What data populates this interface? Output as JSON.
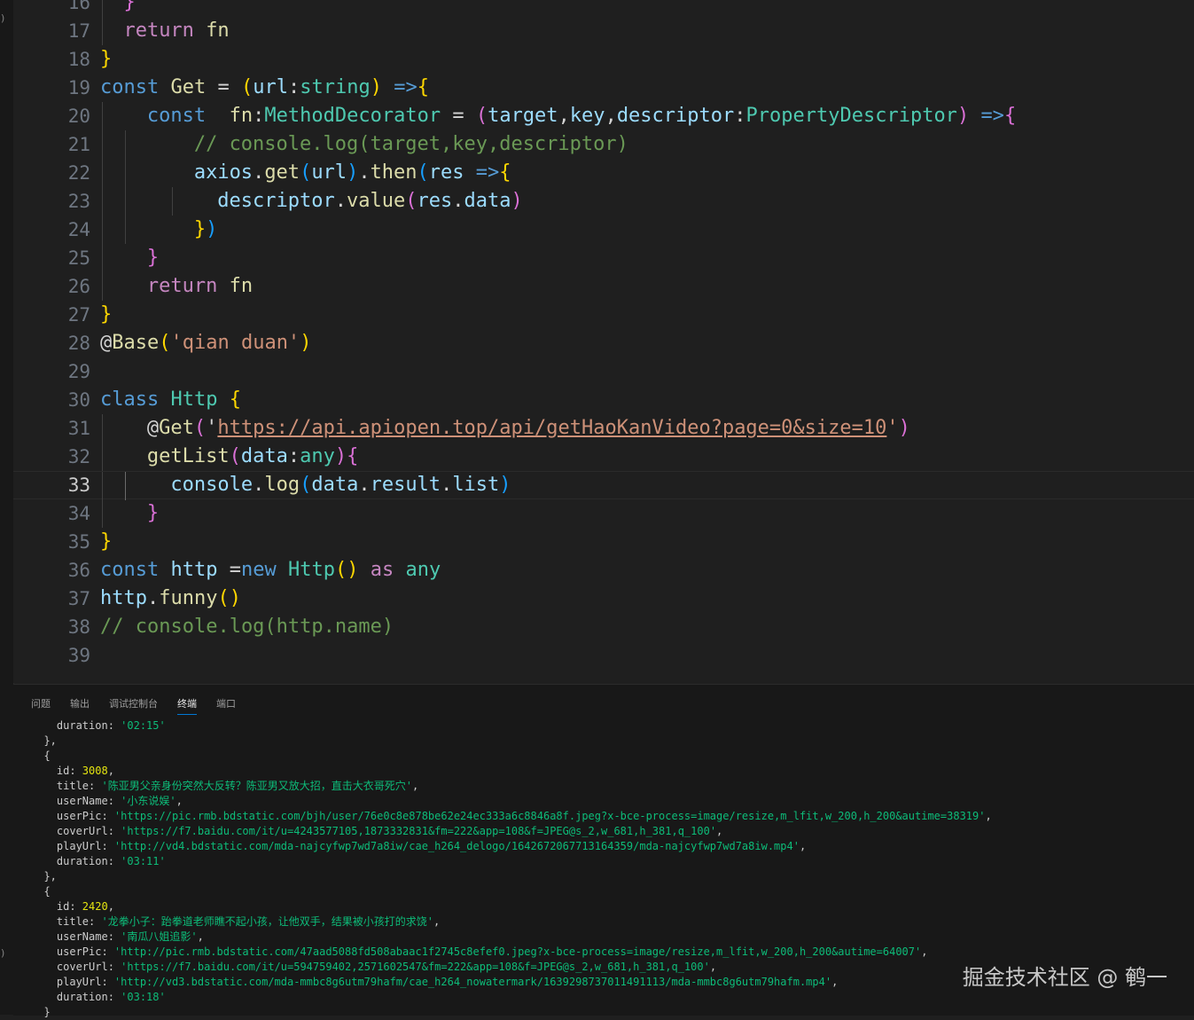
{
  "editor": {
    "lines": [
      {
        "num": "16",
        "tokens": [
          {
            "t": "}",
            "c": "b2"
          }
        ],
        "indent": 1,
        "guides": [
          1
        ]
      },
      {
        "num": "17",
        "tokens": [
          {
            "t": "return",
            "c": "ctl"
          },
          {
            "t": " "
          },
          {
            "t": "fn",
            "c": "fn"
          }
        ],
        "indent": 1,
        "guides": [
          1
        ]
      },
      {
        "num": "18",
        "tokens": [
          {
            "t": "}",
            "c": "b1"
          }
        ]
      },
      {
        "num": "19",
        "tokens": [
          {
            "t": "const",
            "c": "kw"
          },
          {
            "t": " "
          },
          {
            "t": "Get",
            "c": "fn"
          },
          {
            "t": " = "
          },
          {
            "t": "(",
            "c": "b1"
          },
          {
            "t": "url",
            "c": "var"
          },
          {
            "t": ":"
          },
          {
            "t": "string",
            "c": "type"
          },
          {
            "t": ")",
            "c": "b1"
          },
          {
            "t": " "
          },
          {
            "t": "=>",
            "c": "kw"
          },
          {
            "t": "{",
            "c": "b1"
          }
        ]
      },
      {
        "num": "20",
        "tokens": [
          {
            "t": "const",
            "c": "kw"
          },
          {
            "t": "  "
          },
          {
            "t": "fn",
            "c": "fn"
          },
          {
            "t": ":"
          },
          {
            "t": "MethodDecorator",
            "c": "type"
          },
          {
            "t": " = "
          },
          {
            "t": "(",
            "c": "b2"
          },
          {
            "t": "target",
            "c": "var"
          },
          {
            "t": ","
          },
          {
            "t": "key",
            "c": "var"
          },
          {
            "t": ","
          },
          {
            "t": "descriptor",
            "c": "var"
          },
          {
            "t": ":"
          },
          {
            "t": "PropertyDescriptor",
            "c": "type"
          },
          {
            "t": ")",
            "c": "b2"
          },
          {
            "t": " "
          },
          {
            "t": "=>",
            "c": "kw"
          },
          {
            "t": "{",
            "c": "b2"
          }
        ],
        "indent": 2,
        "guides": [
          1
        ]
      },
      {
        "num": "21",
        "tokens": [
          {
            "t": "// console.log(target,key,descriptor)",
            "c": "cm"
          }
        ],
        "indent": 4,
        "guides": [
          1,
          2
        ]
      },
      {
        "num": "22",
        "tokens": [
          {
            "t": "axios",
            "c": "var"
          },
          {
            "t": "."
          },
          {
            "t": "get",
            "c": "fn"
          },
          {
            "t": "(",
            "c": "b3"
          },
          {
            "t": "url",
            "c": "var"
          },
          {
            "t": ")",
            "c": "b3"
          },
          {
            "t": "."
          },
          {
            "t": "then",
            "c": "fn"
          },
          {
            "t": "(",
            "c": "b3"
          },
          {
            "t": "res",
            "c": "var"
          },
          {
            "t": " "
          },
          {
            "t": "=>",
            "c": "kw"
          },
          {
            "t": "{",
            "c": "b1"
          }
        ],
        "indent": 4,
        "guides": [
          1,
          2
        ]
      },
      {
        "num": "23",
        "tokens": [
          {
            "t": "descriptor",
            "c": "var"
          },
          {
            "t": "."
          },
          {
            "t": "value",
            "c": "fn"
          },
          {
            "t": "(",
            "c": "b2"
          },
          {
            "t": "res",
            "c": "var"
          },
          {
            "t": "."
          },
          {
            "t": "data",
            "c": "var"
          },
          {
            "t": ")",
            "c": "b2"
          }
        ],
        "indent": 5,
        "guides": [
          1,
          2,
          4
        ]
      },
      {
        "num": "24",
        "tokens": [
          {
            "t": "}",
            "c": "b1"
          },
          {
            "t": ")",
            "c": "b3"
          }
        ],
        "indent": 4,
        "guides": [
          1,
          2
        ]
      },
      {
        "num": "25",
        "tokens": [
          {
            "t": "}",
            "c": "b2"
          }
        ],
        "indent": 2,
        "guides": [
          1
        ]
      },
      {
        "num": "26",
        "tokens": [
          {
            "t": "return",
            "c": "ctl"
          },
          {
            "t": " "
          },
          {
            "t": "fn",
            "c": "fn"
          }
        ],
        "indent": 2,
        "guides": [
          1
        ]
      },
      {
        "num": "27",
        "tokens": [
          {
            "t": "}",
            "c": "b1"
          }
        ]
      },
      {
        "num": "28",
        "tokens": [
          {
            "t": "@"
          },
          {
            "t": "Base",
            "c": "fn"
          },
          {
            "t": "(",
            "c": "b1"
          },
          {
            "t": "'qian duan'",
            "c": "str"
          },
          {
            "t": ")",
            "c": "b1"
          }
        ]
      },
      {
        "num": "29",
        "tokens": []
      },
      {
        "num": "30",
        "tokens": [
          {
            "t": "class",
            "c": "kw"
          },
          {
            "t": " "
          },
          {
            "t": "Http",
            "c": "cls"
          },
          {
            "t": " "
          },
          {
            "t": "{",
            "c": "b1"
          }
        ]
      },
      {
        "num": "31",
        "tokens": [
          {
            "t": "@"
          },
          {
            "t": "Get",
            "c": "fn"
          },
          {
            "t": "(",
            "c": "b2"
          },
          {
            "t": "'"
          },
          {
            "t": "https://api.apiopen.top/api/getHaoKanVideo?page=0&size=10",
            "c": "str url"
          },
          {
            "t": "'",
            "c": "str"
          },
          {
            "t": ")",
            "c": "b2"
          }
        ],
        "indent": 2,
        "guides": [
          1
        ]
      },
      {
        "num": "32",
        "tokens": [
          {
            "t": "getList",
            "c": "fn"
          },
          {
            "t": "(",
            "c": "b2"
          },
          {
            "t": "data",
            "c": "var"
          },
          {
            "t": ":"
          },
          {
            "t": "any",
            "c": "type"
          },
          {
            "t": ")",
            "c": "b2"
          },
          {
            "t": "{",
            "c": "b2"
          }
        ],
        "indent": 2,
        "guides": [
          1
        ]
      },
      {
        "num": "33",
        "tokens": [
          {
            "t": "console",
            "c": "var"
          },
          {
            "t": "."
          },
          {
            "t": "log",
            "c": "fn"
          },
          {
            "t": "(",
            "c": "b3"
          },
          {
            "t": "data",
            "c": "var"
          },
          {
            "t": "."
          },
          {
            "t": "result",
            "c": "var"
          },
          {
            "t": "."
          },
          {
            "t": "list",
            "c": "var"
          },
          {
            "t": ")",
            "c": "b3"
          }
        ],
        "indent": 3,
        "guides": [
          1,
          2
        ],
        "current": true
      },
      {
        "num": "34",
        "tokens": [
          {
            "t": "}",
            "c": "b2"
          }
        ],
        "indent": 2,
        "guides": [
          1
        ]
      },
      {
        "num": "35",
        "tokens": [
          {
            "t": "}",
            "c": "b1"
          }
        ]
      },
      {
        "num": "36",
        "tokens": [
          {
            "t": "const",
            "c": "kw"
          },
          {
            "t": " "
          },
          {
            "t": "http",
            "c": "var"
          },
          {
            "t": " ="
          },
          {
            "t": "new",
            "c": "kw"
          },
          {
            "t": " "
          },
          {
            "t": "Http",
            "c": "cls"
          },
          {
            "t": "()",
            "c": "b1"
          },
          {
            "t": " "
          },
          {
            "t": "as",
            "c": "ctl"
          },
          {
            "t": " "
          },
          {
            "t": "any",
            "c": "type"
          }
        ]
      },
      {
        "num": "37",
        "tokens": [
          {
            "t": "http",
            "c": "var"
          },
          {
            "t": "."
          },
          {
            "t": "funny",
            "c": "fn"
          },
          {
            "t": "()",
            "c": "b1"
          }
        ]
      },
      {
        "num": "38",
        "tokens": [
          {
            "t": "// console.log(http.name)",
            "c": "cm"
          }
        ]
      },
      {
        "num": "39",
        "tokens": []
      }
    ]
  },
  "panel": {
    "tabs": [
      {
        "label": "问题",
        "active": false
      },
      {
        "label": "输出",
        "active": false
      },
      {
        "label": "调试控制台",
        "active": false
      },
      {
        "label": "终端",
        "active": true
      },
      {
        "label": "端口",
        "active": false
      }
    ],
    "terminal_lines": [
      [
        {
          "t": "    duration: "
        },
        {
          "t": "'02:15'",
          "c": "t-str"
        }
      ],
      [
        {
          "t": "  },"
        }
      ],
      [
        {
          "t": "  {"
        }
      ],
      [
        {
          "t": "    id: "
        },
        {
          "t": "3008",
          "c": "t-num"
        },
        {
          "t": ","
        }
      ],
      [
        {
          "t": "    title: "
        },
        {
          "t": "'陈亚男父亲身份突然大反转？陈亚男又放大招，直击大衣哥死穴'",
          "c": "t-str"
        },
        {
          "t": ","
        }
      ],
      [
        {
          "t": "    userName: "
        },
        {
          "t": "'小东说娱'",
          "c": "t-str"
        },
        {
          "t": ","
        }
      ],
      [
        {
          "t": "    userPic: "
        },
        {
          "t": "'https://pic.rmb.bdstatic.com/bjh/user/76e0c8e878be62e24ec333a6c8846a8f.jpeg?x-bce-process=image/resize,m_lfit,w_200,h_200&autime=38319'",
          "c": "t-str"
        },
        {
          "t": ","
        }
      ],
      [
        {
          "t": "    coverUrl: "
        },
        {
          "t": "'https://f7.baidu.com/it/u=4243577105,1873332831&fm=222&app=108&f=JPEG@s_2,w_681,h_381,q_100'",
          "c": "t-str"
        },
        {
          "t": ","
        }
      ],
      [
        {
          "t": "    playUrl: "
        },
        {
          "t": "'http://vd4.bdstatic.com/mda-najcyfwp7wd7a8iw/cae_h264_delogo/1642672067713164359/mda-najcyfwp7wd7a8iw.mp4'",
          "c": "t-str"
        },
        {
          "t": ","
        }
      ],
      [
        {
          "t": "    duration: "
        },
        {
          "t": "'03:11'",
          "c": "t-str"
        }
      ],
      [
        {
          "t": "  },"
        }
      ],
      [
        {
          "t": "  {"
        }
      ],
      [
        {
          "t": "    id: "
        },
        {
          "t": "2420",
          "c": "t-num"
        },
        {
          "t": ","
        }
      ],
      [
        {
          "t": "    title: "
        },
        {
          "t": "'龙拳小子：跆拳道老师瞧不起小孩，让他双手，结果被小孩打的求饶'",
          "c": "t-str"
        },
        {
          "t": ","
        }
      ],
      [
        {
          "t": "    userName: "
        },
        {
          "t": "'南瓜八姐追影'",
          "c": "t-str"
        },
        {
          "t": ","
        }
      ],
      [
        {
          "t": "    userPic: "
        },
        {
          "t": "'http://pic.rmb.bdstatic.com/47aad5088fd508abaac1f2745c8efef0.jpeg?x-bce-process=image/resize,m_lfit,w_200,h_200&autime=64007'",
          "c": "t-str"
        },
        {
          "t": ","
        }
      ],
      [
        {
          "t": "    coverUrl: "
        },
        {
          "t": "'https://f7.baidu.com/it/u=594759402,2571602547&fm=222&app=108&f=JPEG@s_2,w_681,h_381,q_100'",
          "c": "t-str"
        },
        {
          "t": ","
        }
      ],
      [
        {
          "t": "    playUrl: "
        },
        {
          "t": "'http://vd3.bdstatic.com/mda-mmbc8g6utm79hafm/cae_h264_nowatermark/1639298737011491113/mda-mmbc8g6utm79hafm.mp4'",
          "c": "t-str"
        },
        {
          "t": ","
        }
      ],
      [
        {
          "t": "    duration: "
        },
        {
          "t": "'03:18'",
          "c": "t-str"
        }
      ],
      [
        {
          "t": "  }"
        }
      ]
    ]
  },
  "watermark": "掘金技术社区 @ 鹌一"
}
